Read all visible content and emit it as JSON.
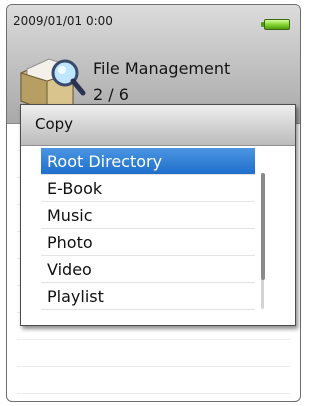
{
  "status_bar": {
    "datetime": "2009/01/01   0:00",
    "battery_icon": "battery-full-icon"
  },
  "app": {
    "icon": "file-folder-magnifier-icon",
    "title": "File Management",
    "page_counter": "2 / 6"
  },
  "dialog": {
    "title": "Copy",
    "items": [
      {
        "label": "Root Directory",
        "selected": true
      },
      {
        "label": "E-Book",
        "selected": false
      },
      {
        "label": "Music",
        "selected": false
      },
      {
        "label": "Photo",
        "selected": false
      },
      {
        "label": "Video",
        "selected": false
      },
      {
        "label": "Playlist",
        "selected": false
      }
    ]
  },
  "colors": {
    "selection": "#1f6fcb",
    "battery": "#7fd12d"
  }
}
